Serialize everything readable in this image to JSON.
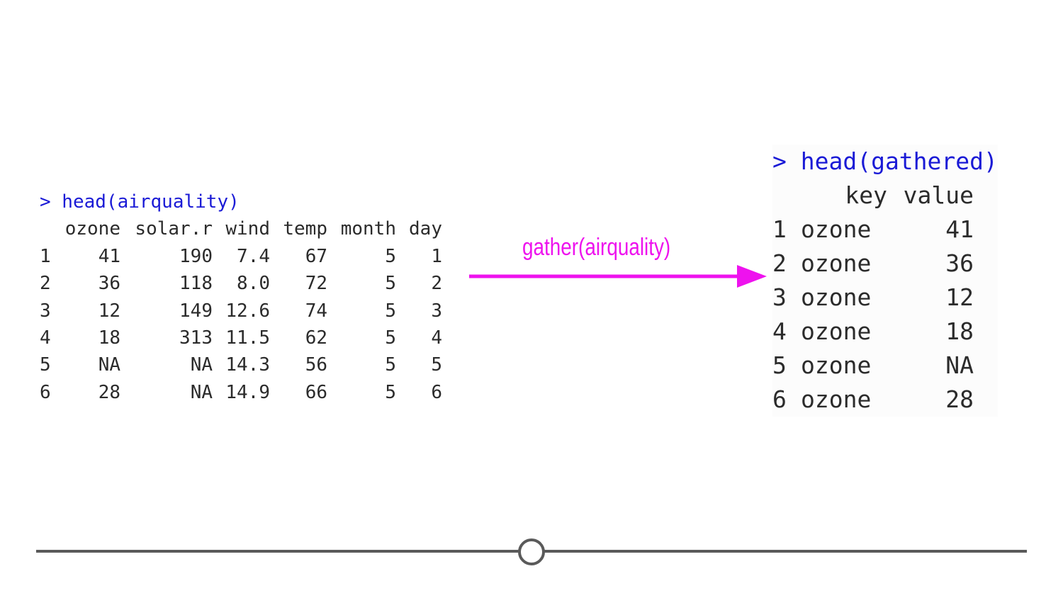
{
  "left_console": {
    "prompt": "> head(airquality)",
    "columns": [
      "ozone",
      "solar.r",
      "wind",
      "temp",
      "month",
      "day"
    ],
    "rows": [
      {
        "row": "1",
        "ozone": "41",
        "solar": "190",
        "wind": "7.4",
        "temp": "67",
        "month": "5",
        "day": "1"
      },
      {
        "row": "2",
        "ozone": "36",
        "solar": "118",
        "wind": "8.0",
        "temp": "72",
        "month": "5",
        "day": "2"
      },
      {
        "row": "3",
        "ozone": "12",
        "solar": "149",
        "wind": "12.6",
        "temp": "74",
        "month": "5",
        "day": "3"
      },
      {
        "row": "4",
        "ozone": "18",
        "solar": "313",
        "wind": "11.5",
        "temp": "62",
        "month": "5",
        "day": "4"
      },
      {
        "row": "5",
        "ozone": "NA",
        "solar": "NA",
        "wind": "14.3",
        "temp": "56",
        "month": "5",
        "day": "5"
      },
      {
        "row": "6",
        "ozone": "28",
        "solar": "NA",
        "wind": "14.9",
        "temp": "66",
        "month": "5",
        "day": "6"
      }
    ]
  },
  "arrow": {
    "label": "gather(airquality)",
    "color": "#ee12ee"
  },
  "right_console": {
    "prompt": "> head(gathered)",
    "columns": [
      "key",
      "value"
    ],
    "rows": [
      {
        "row": "1",
        "key": "ozone",
        "value": "41"
      },
      {
        "row": "2",
        "key": "ozone",
        "value": "36"
      },
      {
        "row": "3",
        "key": "ozone",
        "value": "12"
      },
      {
        "row": "4",
        "key": "ozone",
        "value": "18"
      },
      {
        "row": "5",
        "key": "ozone",
        "value": "NA"
      },
      {
        "row": "6",
        "key": "ozone",
        "value": "28"
      }
    ]
  },
  "colors": {
    "prompt": "#1a1ad6",
    "text": "#2b2b2b",
    "timeline": "#5a5a5a"
  }
}
